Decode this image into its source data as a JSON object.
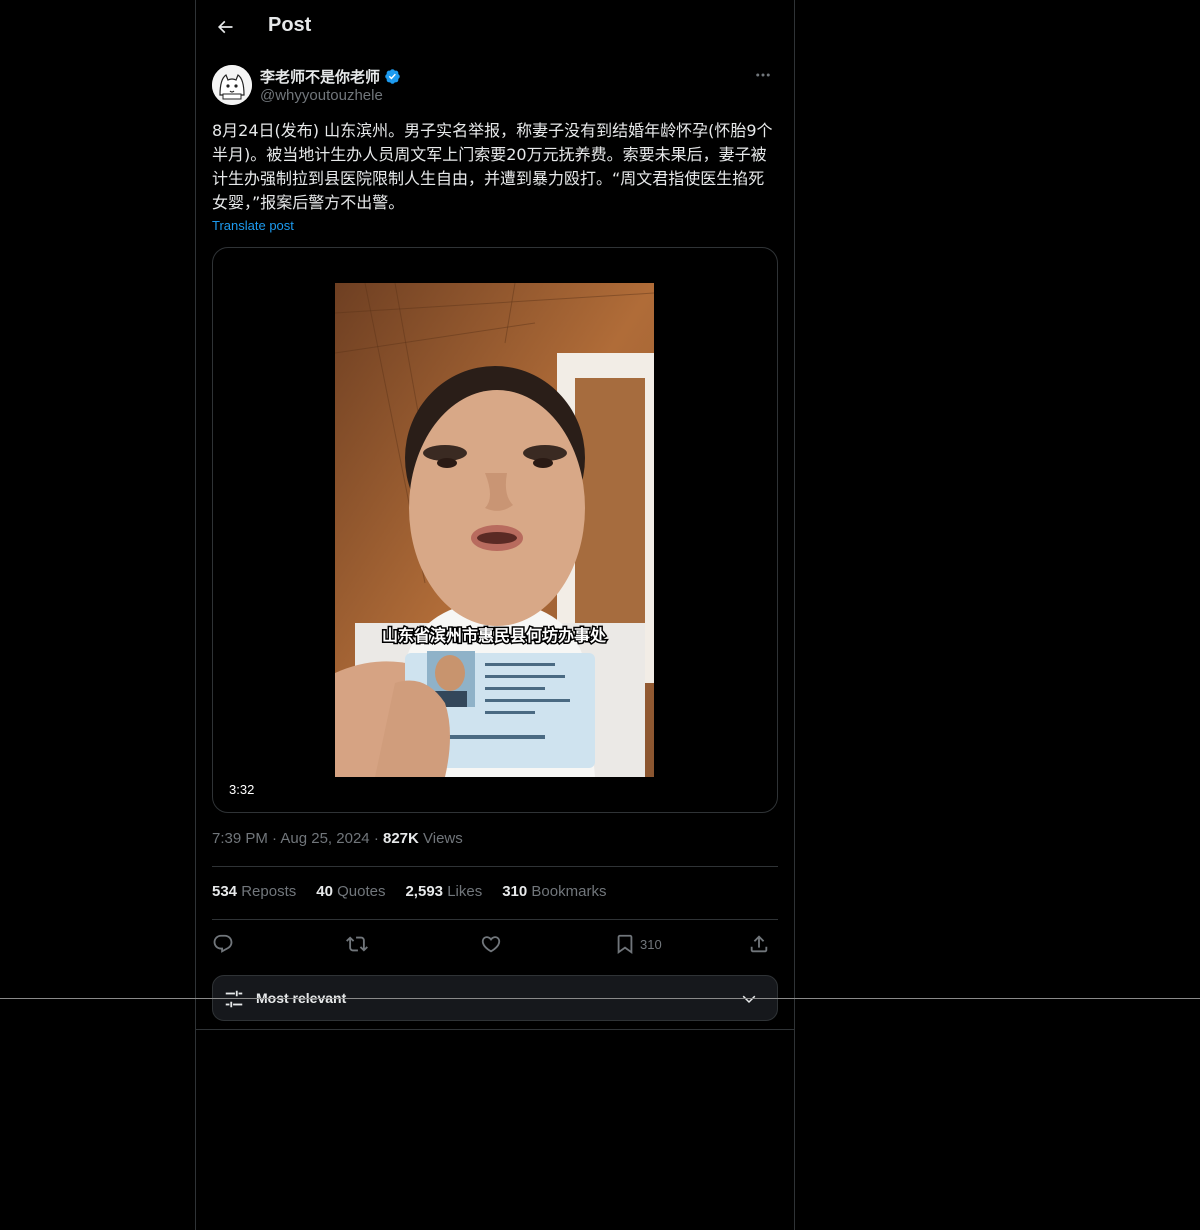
{
  "header": {
    "title": "Post"
  },
  "author": {
    "display_name": "李老师不是你老师",
    "handle": "@whyyoutouzhele",
    "verified": true
  },
  "post": {
    "text": "8月24日(发布) 山东滨州。男子实名举报，称妻子没有到结婚年龄怀孕(怀胎9个半月)。被当地计生办人员周文军上门索要20万元抚养费。索要未果后，妻子被计生办强制拉到县医院限制人生自由，并遭到暴力殴打。“周文君指使医生掐死女婴，”报案后警方不出警。",
    "translate_label": "Translate post",
    "video": {
      "duration": "3:32",
      "caption": "山东省滨州市惠民县何坊办事处"
    }
  },
  "meta": {
    "time": "7:39 PM",
    "date": "Aug 25, 2024",
    "views_count": "827K",
    "views_label": "Views"
  },
  "stats": {
    "reposts_count": "534",
    "reposts_label": "Reposts",
    "quotes_count": "40",
    "quotes_label": "Quotes",
    "likes_count": "2,593",
    "likes_label": "Likes",
    "bookmarks_count": "310",
    "bookmarks_label": "Bookmarks"
  },
  "actions": {
    "bookmark_count": "310"
  },
  "sort": {
    "label": "Most relevant"
  },
  "colors": {
    "background": "#000000",
    "text": "#e7e9ea",
    "secondary": "#71767b",
    "accent": "#1d9bf0",
    "border": "#2f3336"
  }
}
